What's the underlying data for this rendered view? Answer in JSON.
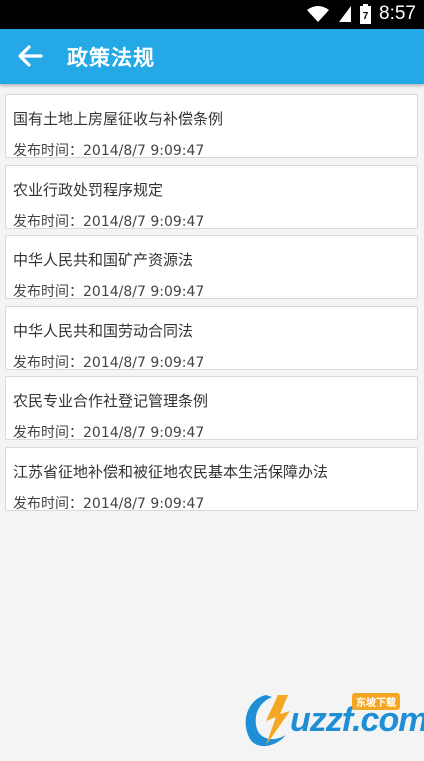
{
  "status_bar": {
    "time": "8:57",
    "battery": "7"
  },
  "app_bar": {
    "title": "政策法规"
  },
  "items": [
    {
      "title": "国有土地上房屋征收与补偿条例",
      "time_label": "发布时间：",
      "time": "2014/8/7 9:09:47"
    },
    {
      "title": "农业行政处罚程序规定",
      "time_label": "发布时间：",
      "time": "2014/8/7 9:09:47"
    },
    {
      "title": "中华人民共和国矿产资源法",
      "time_label": "发布时间：",
      "time": "2014/8/7 9:09:47"
    },
    {
      "title": "中华人民共和国劳动合同法",
      "time_label": "发布时间：",
      "time": "2014/8/7 9:09:47"
    },
    {
      "title": "农民专业合作社登记管理条例",
      "time_label": "发布时间：",
      "time": "2014/8/7 9:09:47"
    },
    {
      "title": "江苏省征地补偿和被征地农民基本生活保障办法",
      "time_label": "发布时间：",
      "time": "2014/8/7 9:09:47"
    }
  ],
  "watermark": {
    "brand": "uzzf.com",
    "badge": "东坡下载"
  },
  "colors": {
    "app_bar": "#24a9e6",
    "background": "#f4f4f4",
    "card": "#ffffff",
    "watermark": "#1e8fd6",
    "badge": "#f5a623"
  }
}
